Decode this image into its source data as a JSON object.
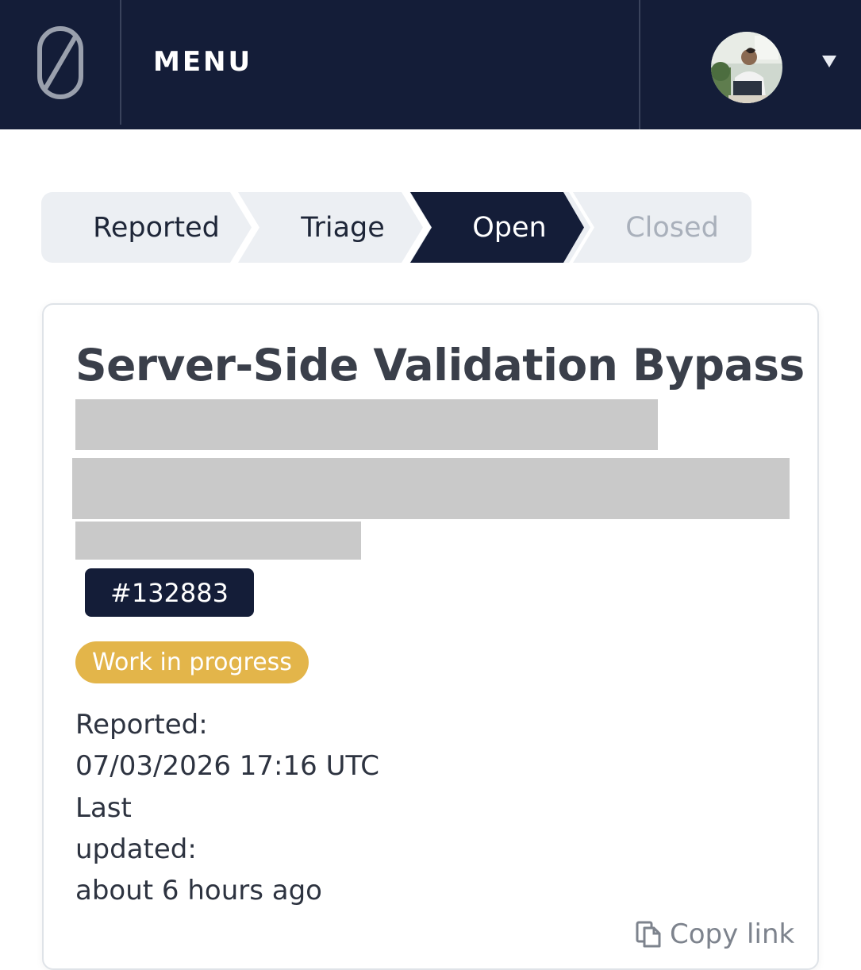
{
  "header": {
    "menu_label": "MENU",
    "logo_icon": "zero-slash-logo-icon",
    "avatar_icon": "user-avatar",
    "caret_icon": "caret-down-icon",
    "bar_color": "#141d38"
  },
  "stepper": {
    "steps": [
      {
        "label": "Reported",
        "state": "done"
      },
      {
        "label": "Triage",
        "state": "done"
      },
      {
        "label": "Open",
        "state": "active"
      },
      {
        "label": "Closed",
        "state": "pending"
      }
    ],
    "active_color": "#141d38"
  },
  "report": {
    "title": "Server-Side Validation Bypass",
    "id": "#132883",
    "status": "Work in progress",
    "status_color": "#e3b54a",
    "reported_label": "Reported:",
    "reported_value": "07/03/2026 17:16 UTC",
    "updated_label_1": "Last",
    "updated_label_2": "updated:",
    "updated_value": "about 6 hours ago",
    "copy_link_label": "Copy link",
    "copy_icon": "copy-icon"
  }
}
